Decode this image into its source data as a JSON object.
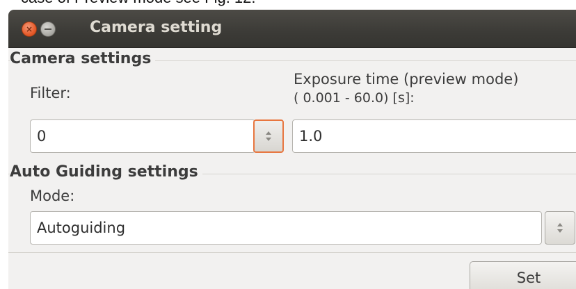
{
  "document": {
    "caption_fragment": "case of Preview mode see Fig. 12."
  },
  "window": {
    "title": "Camera setting",
    "close_symbol": "×"
  },
  "camera_settings": {
    "group_title": "Camera settings",
    "filter": {
      "label": "Filter:",
      "value": "0"
    },
    "exposure": {
      "label_line1": "Exposure time (preview mode)",
      "label_line2": "( 0.001 - 60.0) [s]:",
      "value": "1.0"
    }
  },
  "auto_guiding": {
    "group_title": "Auto Guiding settings",
    "mode_label": "Mode:",
    "mode_value": "Autoguiding"
  },
  "actions": {
    "set_label": "Set"
  },
  "colors": {
    "titlebar": "#3c3b37",
    "window_bg": "#f2f1f0",
    "focus_accent": "#e8763f",
    "close_button": "#e65b2b"
  },
  "icons": {
    "close": "close-icon",
    "minimize": "minimize-icon",
    "spinner": "up-down-arrows-icon"
  }
}
